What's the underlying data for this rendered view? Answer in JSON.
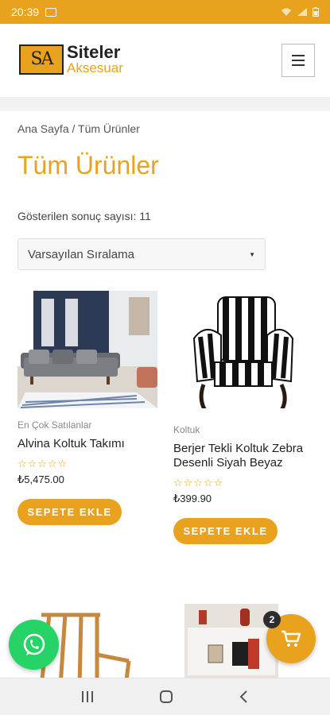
{
  "status_bar": {
    "time": "20:39"
  },
  "header": {
    "logo_mark": "SA",
    "logo_line1": "Siteler",
    "logo_line2": "Aksesuar"
  },
  "breadcrumb": "Ana Sayfa / Tüm Ürünler",
  "page_title": "Tüm Ürünler",
  "result_count": "Gösterilen sonuç sayısı: 11",
  "sort": {
    "selected": "Varsayılan Sıralama"
  },
  "products": [
    {
      "category": "En Çok Satılanlar",
      "name": "Alvina Koltuk Takımı",
      "price": "₺5,475.00",
      "rating": "☆☆☆☆☆",
      "button": "SEPETE EKLE"
    },
    {
      "category": "Koltuk",
      "name": "Berjer Tekli Koltuk Zebra Desenli Siyah Beyaz",
      "price": "₺399.90",
      "rating": "☆☆☆☆☆",
      "button": "SEPETE EKLE"
    }
  ],
  "cart": {
    "count": "2"
  },
  "colors": {
    "accent": "#e9a21d",
    "whatsapp": "#25d366"
  }
}
